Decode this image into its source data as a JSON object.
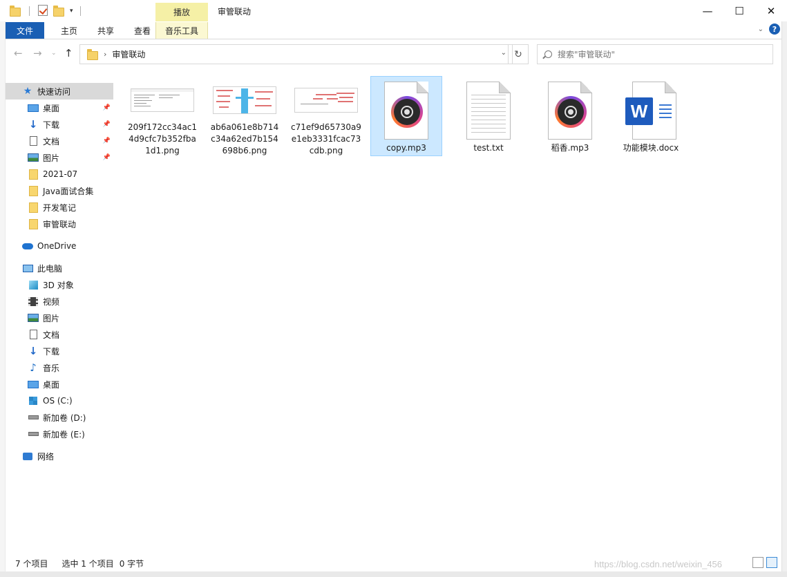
{
  "window": {
    "title": "审管联动",
    "context_tab_header": "播放",
    "minimize": "—",
    "maximize": "☐",
    "close": "✕"
  },
  "ribbon": {
    "tabs": [
      {
        "label": "文件"
      },
      {
        "label": "主页"
      },
      {
        "label": "共享"
      },
      {
        "label": "查看"
      },
      {
        "label": "音乐工具"
      }
    ],
    "help": "?"
  },
  "address": {
    "crumb": "审管联动",
    "search_placeholder": "搜索\"审管联动\""
  },
  "sidebar": {
    "items": [
      {
        "label": "快速访问",
        "icon": "star-icon"
      },
      {
        "label": "桌面",
        "icon": "desktop-icon",
        "pinned": true
      },
      {
        "label": "下载",
        "icon": "download-icon",
        "pinned": true
      },
      {
        "label": "文档",
        "icon": "document-icon",
        "pinned": true
      },
      {
        "label": "图片",
        "icon": "pictures-icon",
        "pinned": true
      },
      {
        "label": "2021-07",
        "icon": "folder-icon"
      },
      {
        "label": "Java面试合集",
        "icon": "folder-icon"
      },
      {
        "label": "开发笔记",
        "icon": "folder-icon"
      },
      {
        "label": "审管联动",
        "icon": "folder-icon"
      },
      {
        "label": "OneDrive",
        "icon": "onedrive-icon"
      },
      {
        "label": "此电脑",
        "icon": "this-pc-icon"
      },
      {
        "label": "3D 对象",
        "icon": "3d-objects-icon"
      },
      {
        "label": "视频",
        "icon": "videos-icon"
      },
      {
        "label": "图片",
        "icon": "pictures-icon"
      },
      {
        "label": "文档",
        "icon": "document-icon"
      },
      {
        "label": "下载",
        "icon": "download-icon"
      },
      {
        "label": "音乐",
        "icon": "music-icon"
      },
      {
        "label": "桌面",
        "icon": "desktop-icon"
      },
      {
        "label": "OS (C:)",
        "icon": "os-drive-icon"
      },
      {
        "label": "新加卷 (D:)",
        "icon": "drive-icon"
      },
      {
        "label": "新加卷 (E:)",
        "icon": "drive-icon"
      },
      {
        "label": "网络",
        "icon": "network-icon"
      }
    ]
  },
  "files": [
    {
      "name": "209f172cc34ac14d9cfc7b352fba1d1.png",
      "type": "png"
    },
    {
      "name": "ab6a061e8b714c34a62ed7b154698b6.png",
      "type": "png"
    },
    {
      "name": "c71ef9d65730a9e1eb3331fcac73cdb.png",
      "type": "png"
    },
    {
      "name": "copy.mp3",
      "type": "mp3",
      "selected": true
    },
    {
      "name": "test.txt",
      "type": "txt"
    },
    {
      "name": "稻香.mp3",
      "type": "mp3"
    },
    {
      "name": "功能模块.docx",
      "type": "docx"
    }
  ],
  "status": {
    "count": "7 个项目",
    "selected": "选中 1 个项目",
    "size": "0 字节"
  },
  "watermark": "https://blog.csdn.net/weixin_456",
  "colors": {
    "accent": "#1a5fb4",
    "selection": "#cce8ff",
    "context_tab": "#f5f0a6"
  }
}
